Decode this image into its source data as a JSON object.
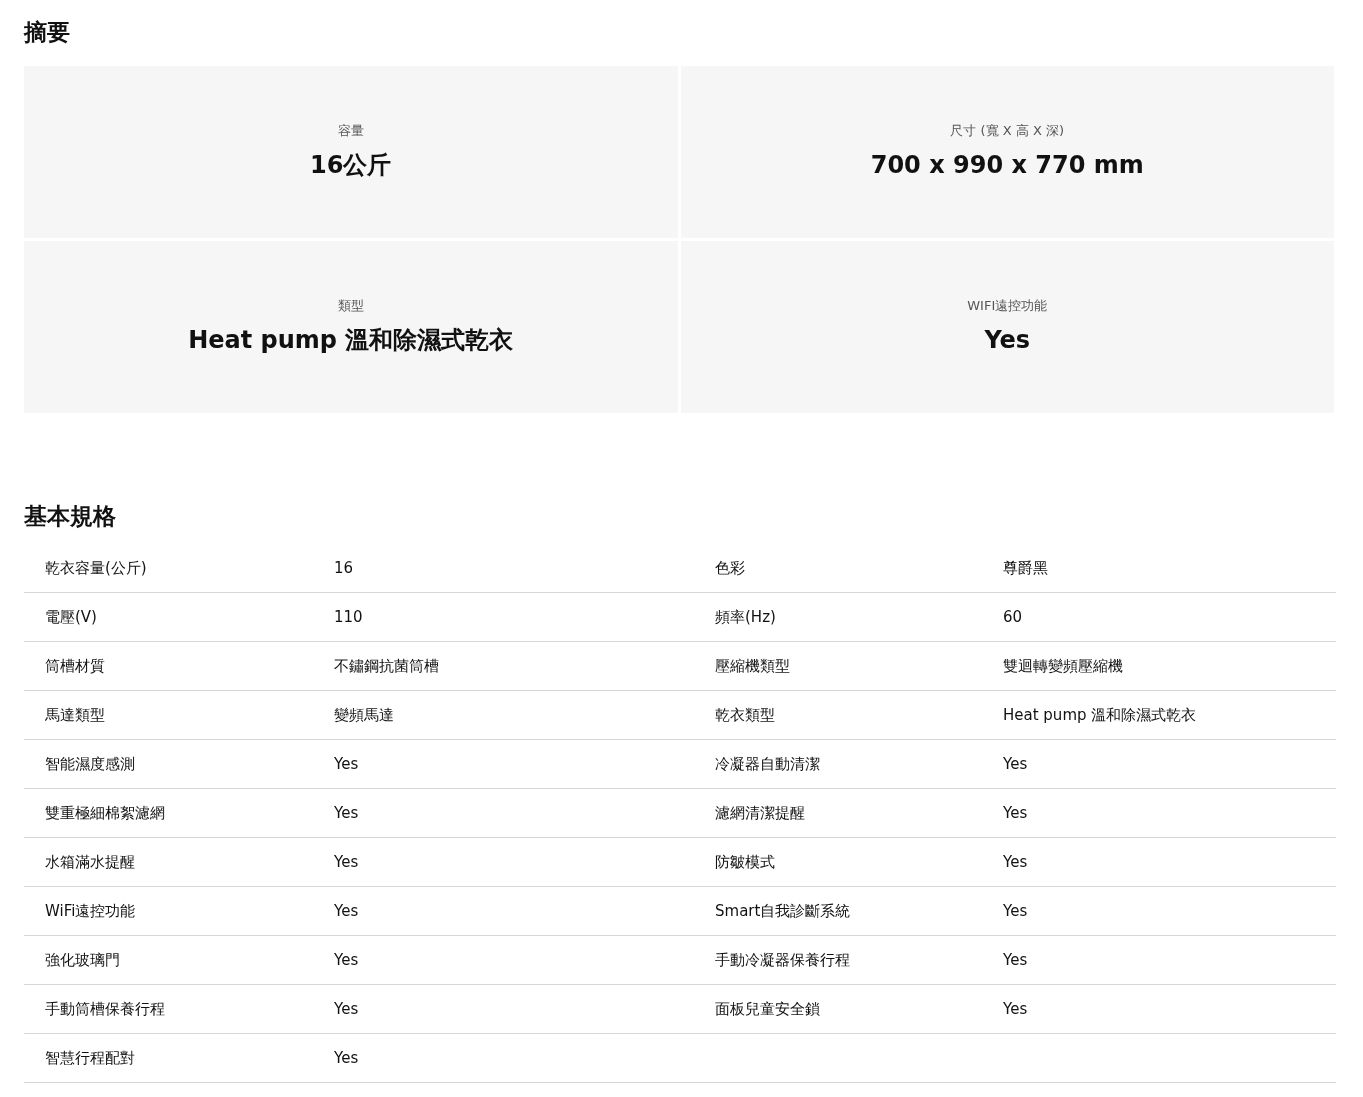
{
  "summary": {
    "title": "摘要",
    "items": [
      {
        "label": "容量",
        "value": "16公斤"
      },
      {
        "label": "尺寸 (寬 X 高 X 深)",
        "value": "700 x 990 x 770 mm"
      },
      {
        "label": "類型",
        "value": "Heat pump 溫和除濕式乾衣"
      },
      {
        "label": "WIFI遠控功能",
        "value": "Yes"
      }
    ]
  },
  "specs": {
    "title": "基本規格",
    "rows": [
      [
        "乾衣容量(公斤)",
        "16",
        "色彩",
        "尊爵黑"
      ],
      [
        "電壓(V)",
        "110",
        "頻率(Hz)",
        "60"
      ],
      [
        "筒槽材質",
        "不鏽鋼抗菌筒槽",
        "壓縮機類型",
        "雙迴轉變頻壓縮機"
      ],
      [
        "馬達類型",
        "變頻馬達",
        "乾衣類型",
        "Heat pump 溫和除濕式乾衣"
      ],
      [
        "智能濕度感測",
        "Yes",
        "冷凝器自動清潔",
        "Yes"
      ],
      [
        "雙重極細棉絮濾網",
        "Yes",
        "濾網清潔提醒",
        "Yes"
      ],
      [
        "水箱滿水提醒",
        "Yes",
        "防皺模式",
        "Yes"
      ],
      [
        "WiFi遠控功能",
        "Yes",
        "Smart自我診斷系統",
        "Yes"
      ],
      [
        "強化玻璃門",
        "Yes",
        "手動冷凝器保養行程",
        "Yes"
      ],
      [
        "手動筒槽保養行程",
        "Yes",
        "面板兒童安全鎖",
        "Yes"
      ],
      [
        "智慧行程配對",
        "Yes"
      ]
    ]
  }
}
